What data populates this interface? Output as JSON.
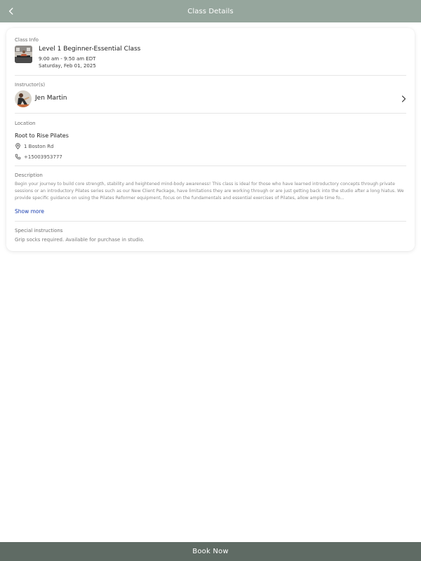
{
  "header": {
    "title": "Class Details",
    "back_icon": "chevron-left-icon"
  },
  "class_info": {
    "label": "Class Info",
    "title": "Level 1 Beginner-Essential Class",
    "time": "9:00 am - 9:50 am EDT",
    "date": "Saturday, Feb 01, 2025"
  },
  "instructors": {
    "label": "Instructor(s)",
    "items": [
      {
        "name": "Jen Martin"
      }
    ]
  },
  "location": {
    "label": "Location",
    "name": "Root to Rise Pilates",
    "address": "1 Boston Rd",
    "phone": "+15003953777"
  },
  "description": {
    "label": "Description",
    "text": "Begin your journey to build core strength, stability and heightened mind-body awareness! This class is ideal for those who have learned introductory concepts through private sessions or an introductory Pilates series such as our New Client Package, have limitations they are working through or are just getting back into the studio after a long hiatus. We provide specific guidance on using the Pilates Reformer equipment, focus on the fundamentals and essential exercises of Pilates, allow ample time fo...",
    "show_more": "Show more"
  },
  "special_instructions": {
    "label": "Special instructions",
    "text": "Grip socks required. Available for purchase in studio."
  },
  "footer": {
    "book_label": "Book Now"
  },
  "colors": {
    "header_bg": "#96a69d",
    "footer_bg": "#5f6b64",
    "link": "#1a3fb0"
  }
}
